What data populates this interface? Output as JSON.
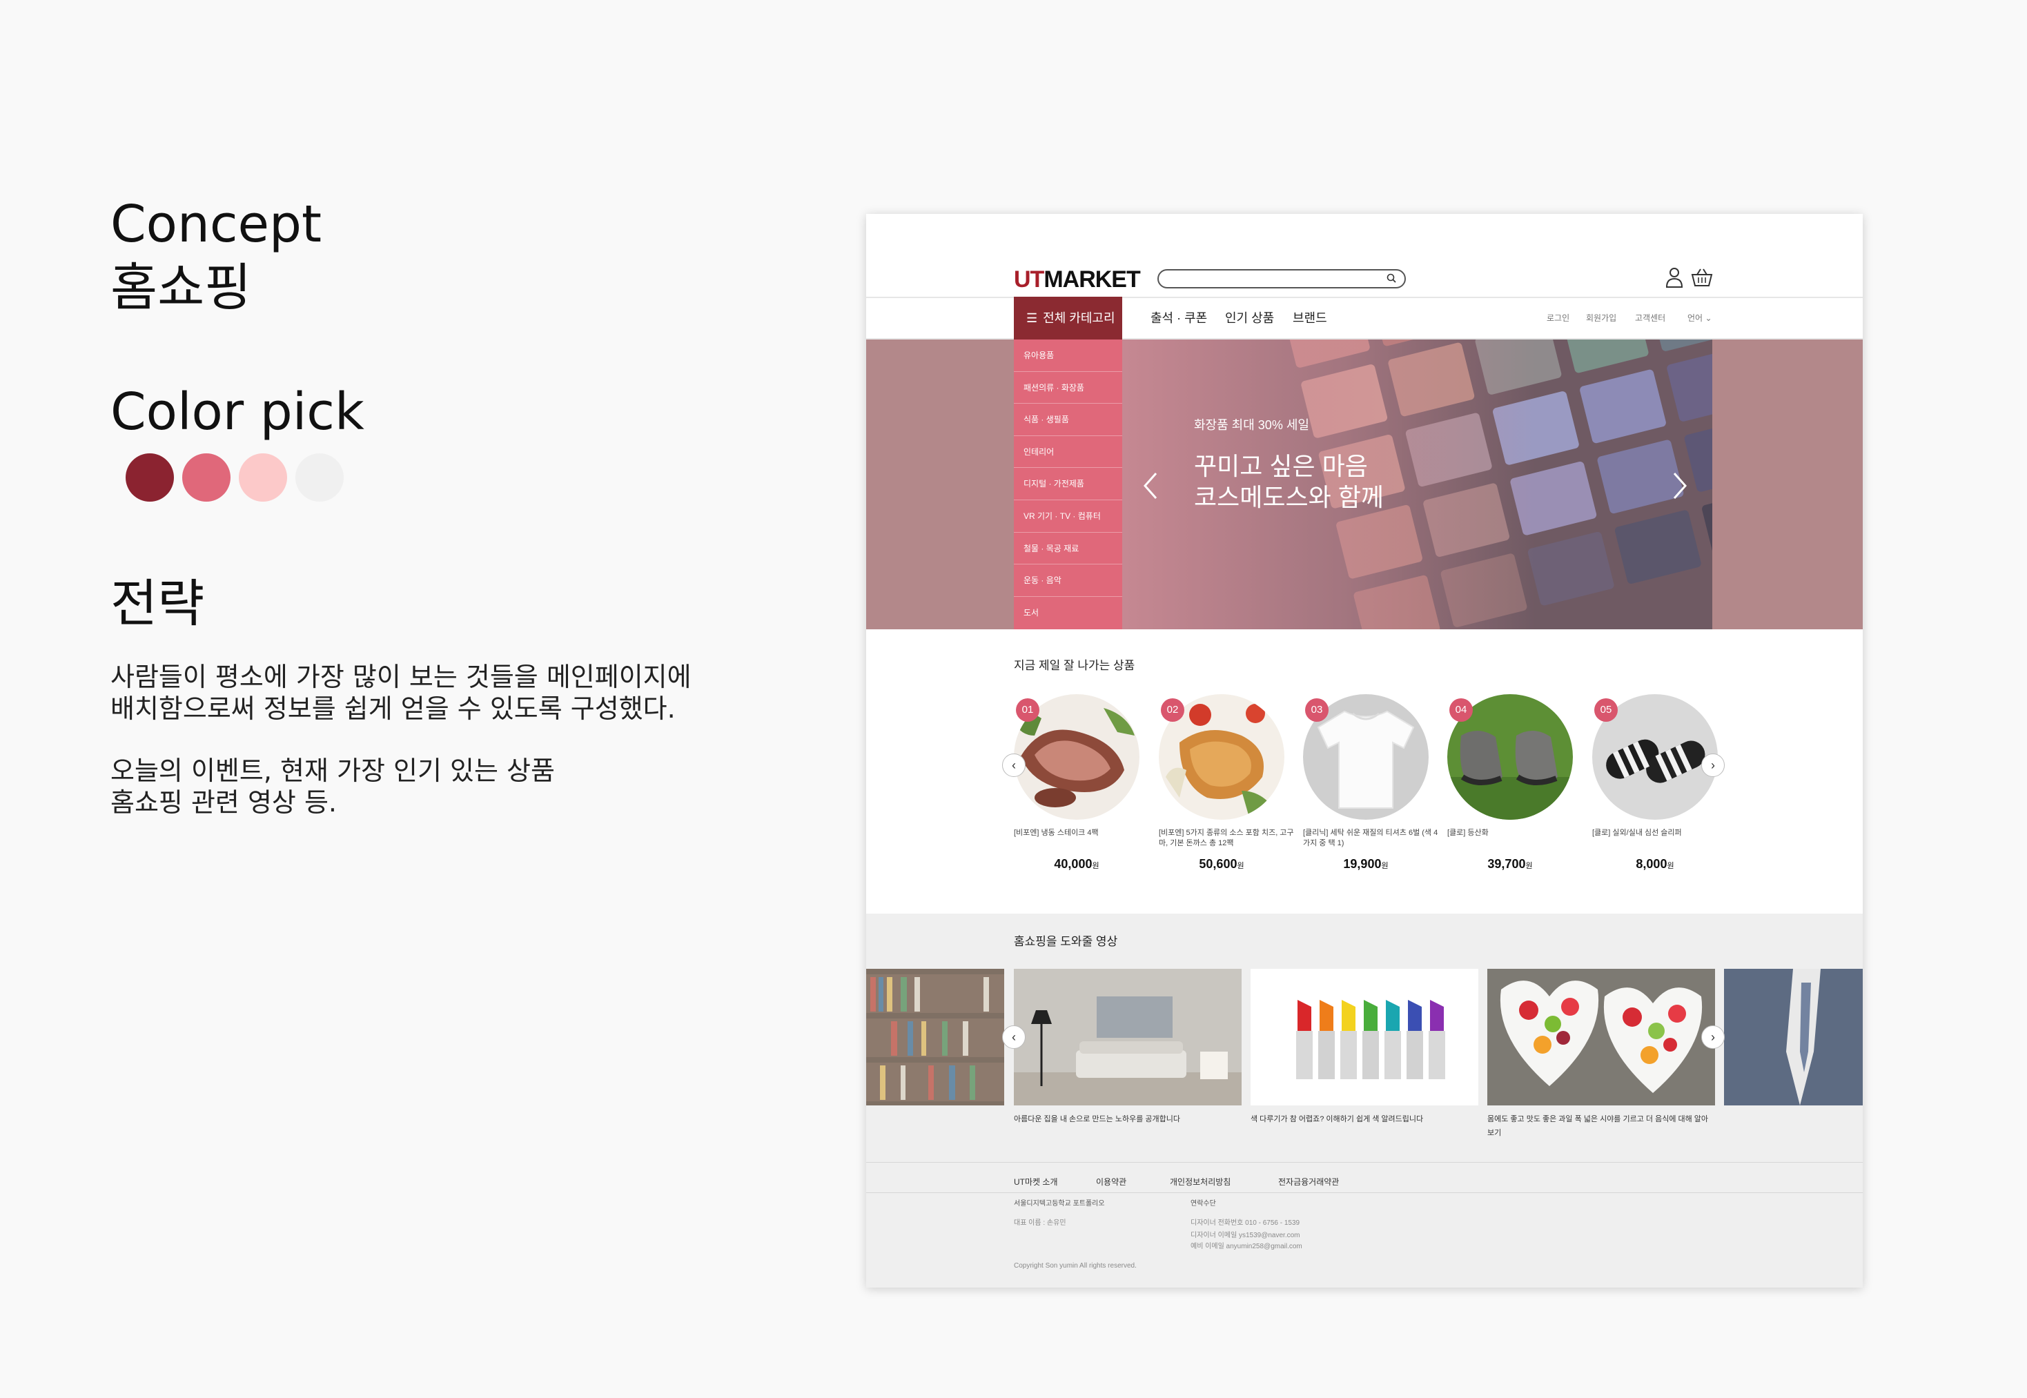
{
  "concept": {
    "title": "Concept",
    "subtitle": "홈쇼핑"
  },
  "color_pick": {
    "title": "Color pick",
    "colors": [
      "#8b2330",
      "#e0687a",
      "#fcc9c9",
      "#f0f0f0"
    ]
  },
  "strategy": {
    "title": "전략",
    "para1_line1": "사람들이 평소에 가장 많이 보는 것들을 메인페이지에",
    "para1_line2": "배치함으로써 정보를 쉽게 얻을 수 있도록 구성했다.",
    "para2_line1": "오늘의 이벤트, 현재 가장 인기 있는 상품",
    "para2_line2": "홈쇼핑 관련 영상 등."
  },
  "site": {
    "logo_ut": "UT",
    "logo_market": "MARKET",
    "search_placeholder": "",
    "icons": {
      "search": "search-icon",
      "user": "user-icon",
      "cart": "basket-icon"
    },
    "category_button": "전체 카테고리",
    "nav": [
      "출석 · 쿠폰",
      "인기 상품",
      "브랜드"
    ],
    "util": [
      "로그인",
      "회원가입",
      "고객센터",
      "언어"
    ],
    "side_menu": [
      "유아용품",
      "패션의류 · 화장품",
      "식품 · 생필품",
      "인테리어",
      "디지털 · 가전제품",
      "VR 기기 · TV · 컴퓨터",
      "철물 · 목공 재료",
      "운동 · 음악",
      "도서"
    ],
    "hero": {
      "sub": "화장품 최대 30% 세일",
      "title_line1": "꾸미고 싶은 마음",
      "title_line2": "코스메도스와 함께"
    },
    "best": {
      "title": "지금 제일 잘 나가는 상품",
      "items": [
        {
          "rank": "01",
          "name": "[비포엔] 냉동 스테이크 4팩",
          "price": "40,000",
          "unit": "원"
        },
        {
          "rank": "02",
          "name": "[비포엔] 5가지 종류의 소스 포함 치즈, 고구마, 기본 돈까스 총 12팩",
          "price": "50,600",
          "unit": "원"
        },
        {
          "rank": "03",
          "name": "[클리닉] 세탁 쉬운 재질의 티셔츠 6벌 (색 4가지 중 택 1)",
          "price": "19,900",
          "unit": "원"
        },
        {
          "rank": "04",
          "name": "[클로] 등산화",
          "price": "39,700",
          "unit": "원"
        },
        {
          "rank": "05",
          "name": "[클로] 실외/실내 심선 슬리퍼",
          "price": "8,000",
          "unit": "원"
        }
      ]
    },
    "videos": {
      "title": "홈쇼핑을 도와줄 영상",
      "items": [
        {
          "caption": "아름다운 집을 내 손으로 만드는 노하우를 공개합니다"
        },
        {
          "caption": "색 다루기가 참 어렵죠? 이해하기 쉽게 색 알려드립니다"
        },
        {
          "caption": "몸에도 좋고 맛도 좋은 과일 폭 넓은 시야를 기르고 더 음식에 대해 알아보기"
        }
      ]
    },
    "footer": {
      "links": [
        "UT마켓 소개",
        "이용약관",
        "개인정보처리방침",
        "전자금융거래약관"
      ],
      "company": "서울디지텍고등학교 포트폴리오",
      "ceo": "대표 이름 : 손유민",
      "contact_title": "연락수단",
      "contact1": "디자이너 전화번호 010 - 6756 - 1539",
      "contact2": "디자이너 이메일 ys1539@naver.com",
      "contact3": "예비 이메일 anyumin258@gmail.com",
      "copyright": "Copyright Son yumin All rights reserved."
    }
  }
}
